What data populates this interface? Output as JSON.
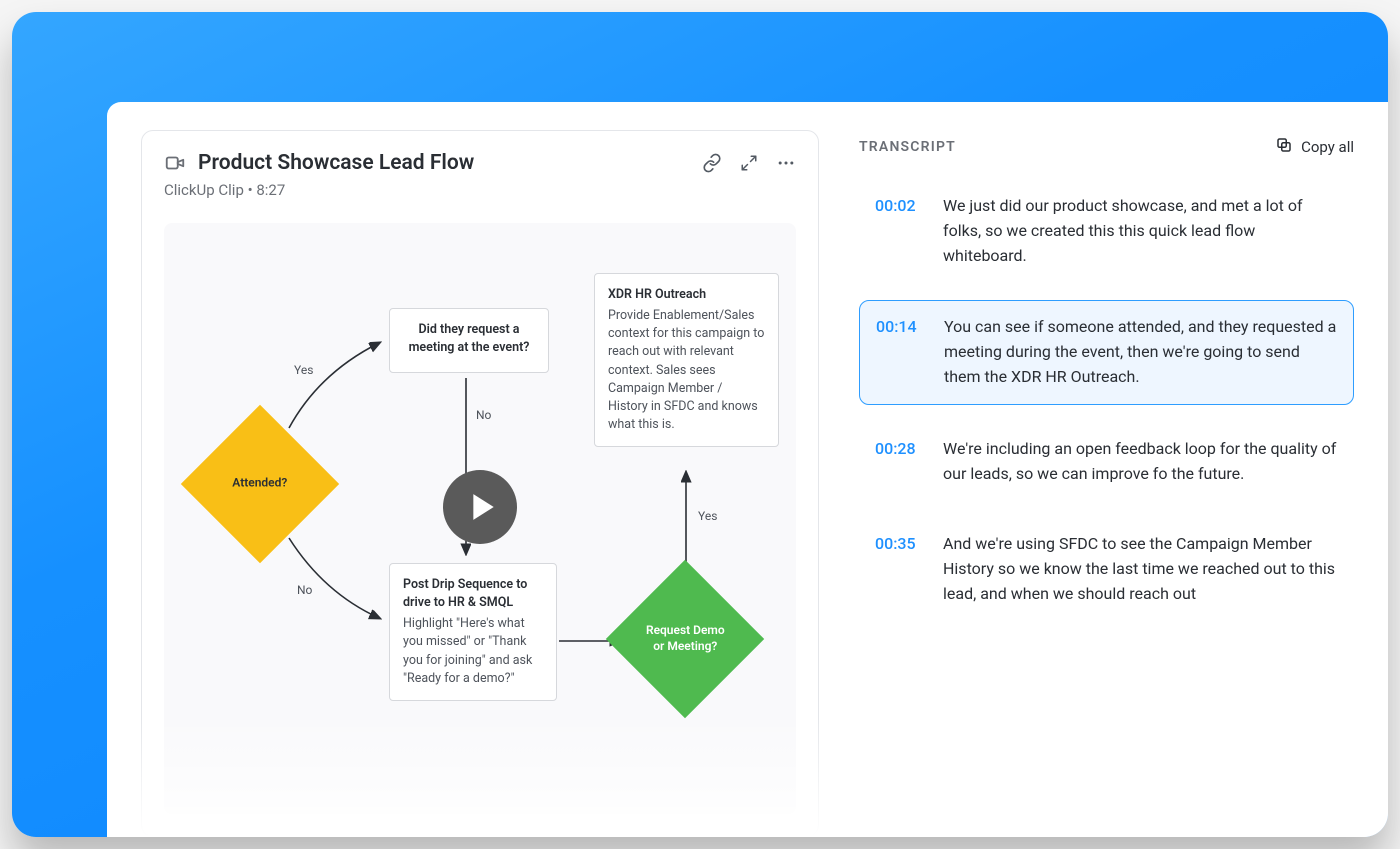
{
  "clip": {
    "title": "Product Showcase Lead Flow",
    "meta": "ClickUp Clip • 8:27"
  },
  "flow": {
    "attended": "Attended?",
    "yes1": "Yes",
    "no1": "No",
    "meetingQ": "Did they request a meeting at the event?",
    "no2": "No",
    "outreach_title": "XDR HR Outreach",
    "outreach_body": "Provide Enablement/Sales context for this campaign to reach out with relevant context. Sales sees Campaign Member / History in SFDC and knows what this is.",
    "drip_title": "Post Drip Sequence to drive to HR & SMQL",
    "drip_body": "Highlight \"Here's what you missed\" or \"Thank you for joining\" and ask \"Ready for a demo?\"",
    "demoQ": "Request Demo or Meeting?",
    "yes2": "Yes"
  },
  "transcript": {
    "heading": "TRANSCRIPT",
    "copy_label": "Copy all",
    "items": [
      {
        "time": "00:02",
        "text": "We just did our product showcase, and met a lot of folks, so we created this this quick lead flow whiteboard."
      },
      {
        "time": "00:14",
        "text": "You can see if someone attended, and they requested a meeting during the event, then we're going to send them the XDR HR Outreach."
      },
      {
        "time": "00:28",
        "text": "We're including an open feedback loop for the quality of our leads, so we can improve fo the future."
      },
      {
        "time": "00:35",
        "text": "And we're using SFDC to see the Campaign Member History so we know the last time we reached out to this lead, and when we should reach out"
      }
    ]
  }
}
